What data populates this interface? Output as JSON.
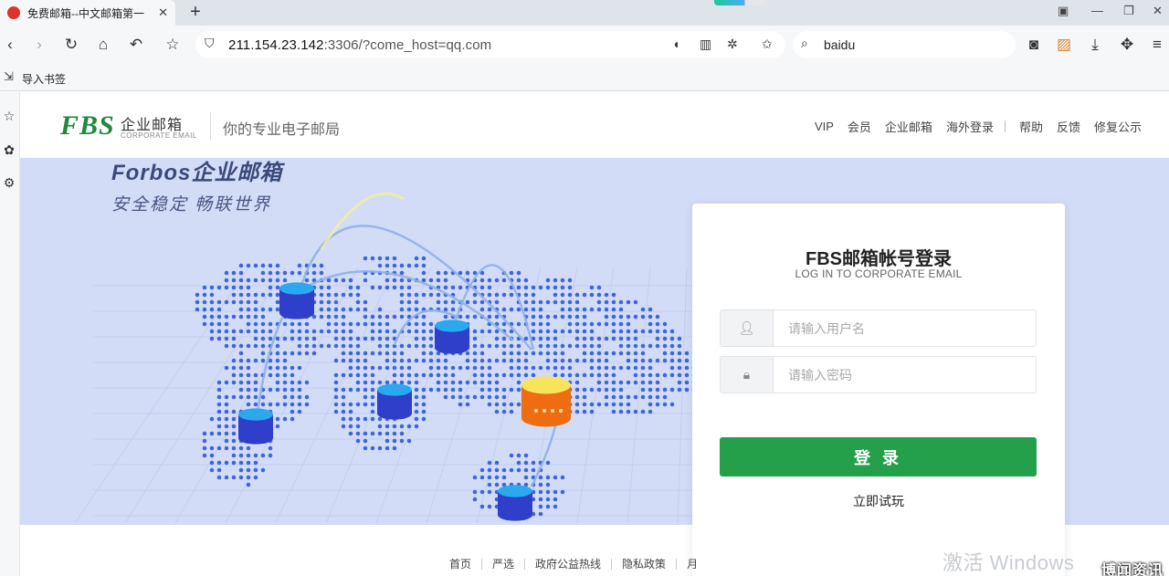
{
  "browser": {
    "tab_title": "免费邮箱--中文邮箱第一",
    "tab_close": "✕",
    "new_tab": "+",
    "url_host": "211.154.23.142",
    "url_rest": ":3306/?come_host=qq.com",
    "search_text": "baidu",
    "bookmark_label": "导入书签"
  },
  "header": {
    "logo": "FBS",
    "logo_cn": "企业邮箱",
    "logo_en": "CORPORATE EMAIL",
    "slogan": "你的专业电子邮局",
    "nav": [
      "VIP",
      "会员",
      "企业邮箱",
      "海外登录",
      "帮助",
      "反馈",
      "修复公示"
    ]
  },
  "banner": {
    "brand_line": "Forbos企业邮箱",
    "tagline": "安全稳定  畅联世界"
  },
  "login": {
    "title": "FBS邮箱帐号登录",
    "subtitle": "LOG IN TO CORPORATE EMAIL",
    "username_placeholder": "请输入用户名",
    "password_placeholder": "请输入密码",
    "submit_label": "登 录",
    "trial_label": "立即试玩"
  },
  "footer": {
    "links": [
      "首页",
      "严选",
      "政府公益热线",
      "隐私政策",
      "月"
    ]
  },
  "overlay": {
    "watermark": "激活 Windows",
    "corner_badge": "博闻资讯"
  },
  "colors": {
    "brand_green": "#1e8a3e",
    "button_green": "#24a04b",
    "banner_bg": "#d3dcf6"
  }
}
